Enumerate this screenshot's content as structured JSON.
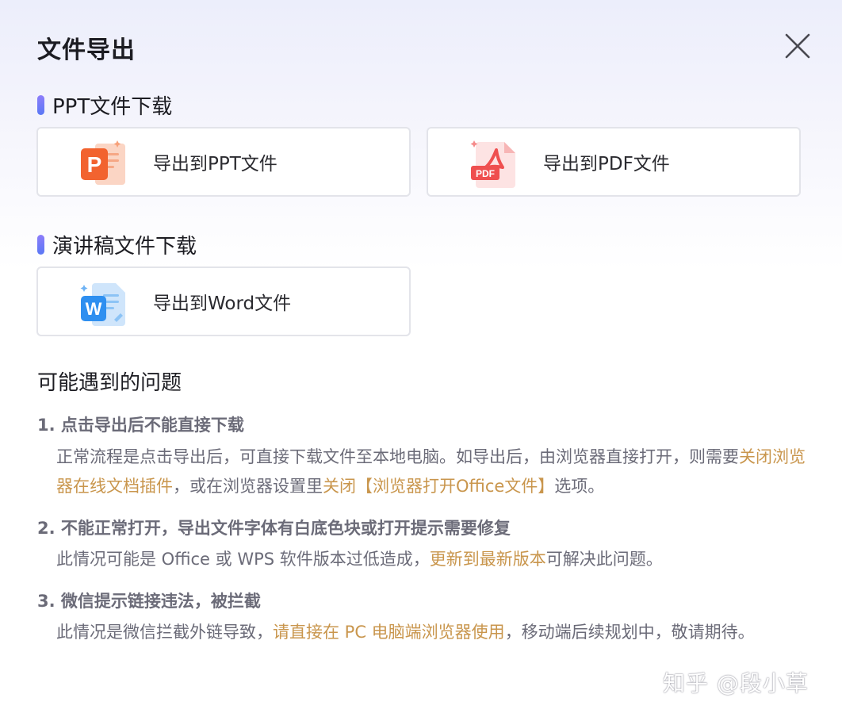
{
  "dialog": {
    "title": "文件导出"
  },
  "sections": {
    "ppt": {
      "title": "PPT文件下载",
      "export_ppt_label": "导出到PPT文件",
      "export_pdf_label": "导出到PDF文件",
      "pdf_badge": "PDF"
    },
    "speech": {
      "title": "演讲稿文件下载",
      "export_word_label": "导出到Word文件",
      "word_badge": "W"
    }
  },
  "faq": {
    "title": "可能遇到的问题",
    "items": [
      {
        "question": "1. 点击导出后不能直接下载",
        "answer_parts": [
          "正常流程是点击导出后，可直接下载文件至本地电脑。如导出后，由浏览器直接打开，则需要",
          "关闭浏览器在线文档插件",
          "，或在浏览器设置里",
          "关闭【浏览器打开Office文件】",
          "选项。"
        ]
      },
      {
        "question": "2. 不能正常打开，导出文件字体有白底色块或打开提示需要修复",
        "answer_parts": [
          "此情况可能是 Office 或 WPS 软件版本过低造成，",
          "更新到最新版本",
          "可解决此问题。"
        ]
      },
      {
        "question": "3. 微信提示链接违法，被拦截",
        "answer_parts": [
          "此情况是微信拦截外链导致，",
          "请直接在 PC 电脑端浏览器使用",
          "，移动端后续规划中，敬请期待。"
        ]
      }
    ]
  },
  "watermark": "知乎 @段小草",
  "colors": {
    "accent": "#6a79f5",
    "highlight": "#c9964d",
    "ppt": "#f2632f",
    "pdf": "#ef4f4f",
    "word": "#2e8ff0"
  }
}
